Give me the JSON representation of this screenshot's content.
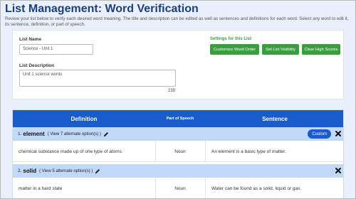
{
  "page": {
    "title": "List Management: Word Verification",
    "intro": "Review your list below to verify each desired word meaning. The title and description can be edited as well as sentences and definitions for each word. Select any word to edit it, its sentence, definition, or part of speech."
  },
  "form": {
    "list_name_label": "List Name",
    "list_name_value": "Science - Unit 1",
    "list_description_label": "List Description",
    "list_description_value": "Unit 1 science words",
    "char_counter": "235"
  },
  "settings": {
    "label": "Settings for this List",
    "buttons": [
      "Customize Word Order",
      "Set List Visibility",
      "Clear High Scores"
    ]
  },
  "table": {
    "headers": {
      "definition": "Definition",
      "part_of_speech": "Part of Speech",
      "sentence": "Sentence"
    },
    "words": [
      {
        "number": "1.",
        "word": "element",
        "alt_link": "( View 7 alternate option(s) )",
        "badge": "Custom",
        "definition": "chemical substance made up of one type of atoms",
        "part_of_speech": "Noun",
        "sentence": "An element is a basic type of matter."
      },
      {
        "number": "2.",
        "word": "solid",
        "alt_link": "( View 5 alternate option(s) )",
        "badge": "",
        "definition": "matter in a hard state",
        "part_of_speech": "Noun",
        "sentence": "Water can be found as a solid, liquid or gas."
      }
    ]
  },
  "colors": {
    "title": "#1c3f7a",
    "header_blue": "#1a5ccc",
    "word_row": "#c2d8f7",
    "green": "#3a9e3f",
    "background": "#eaf0fb"
  },
  "icons": [
    "pencil-icon",
    "close-icon"
  ]
}
